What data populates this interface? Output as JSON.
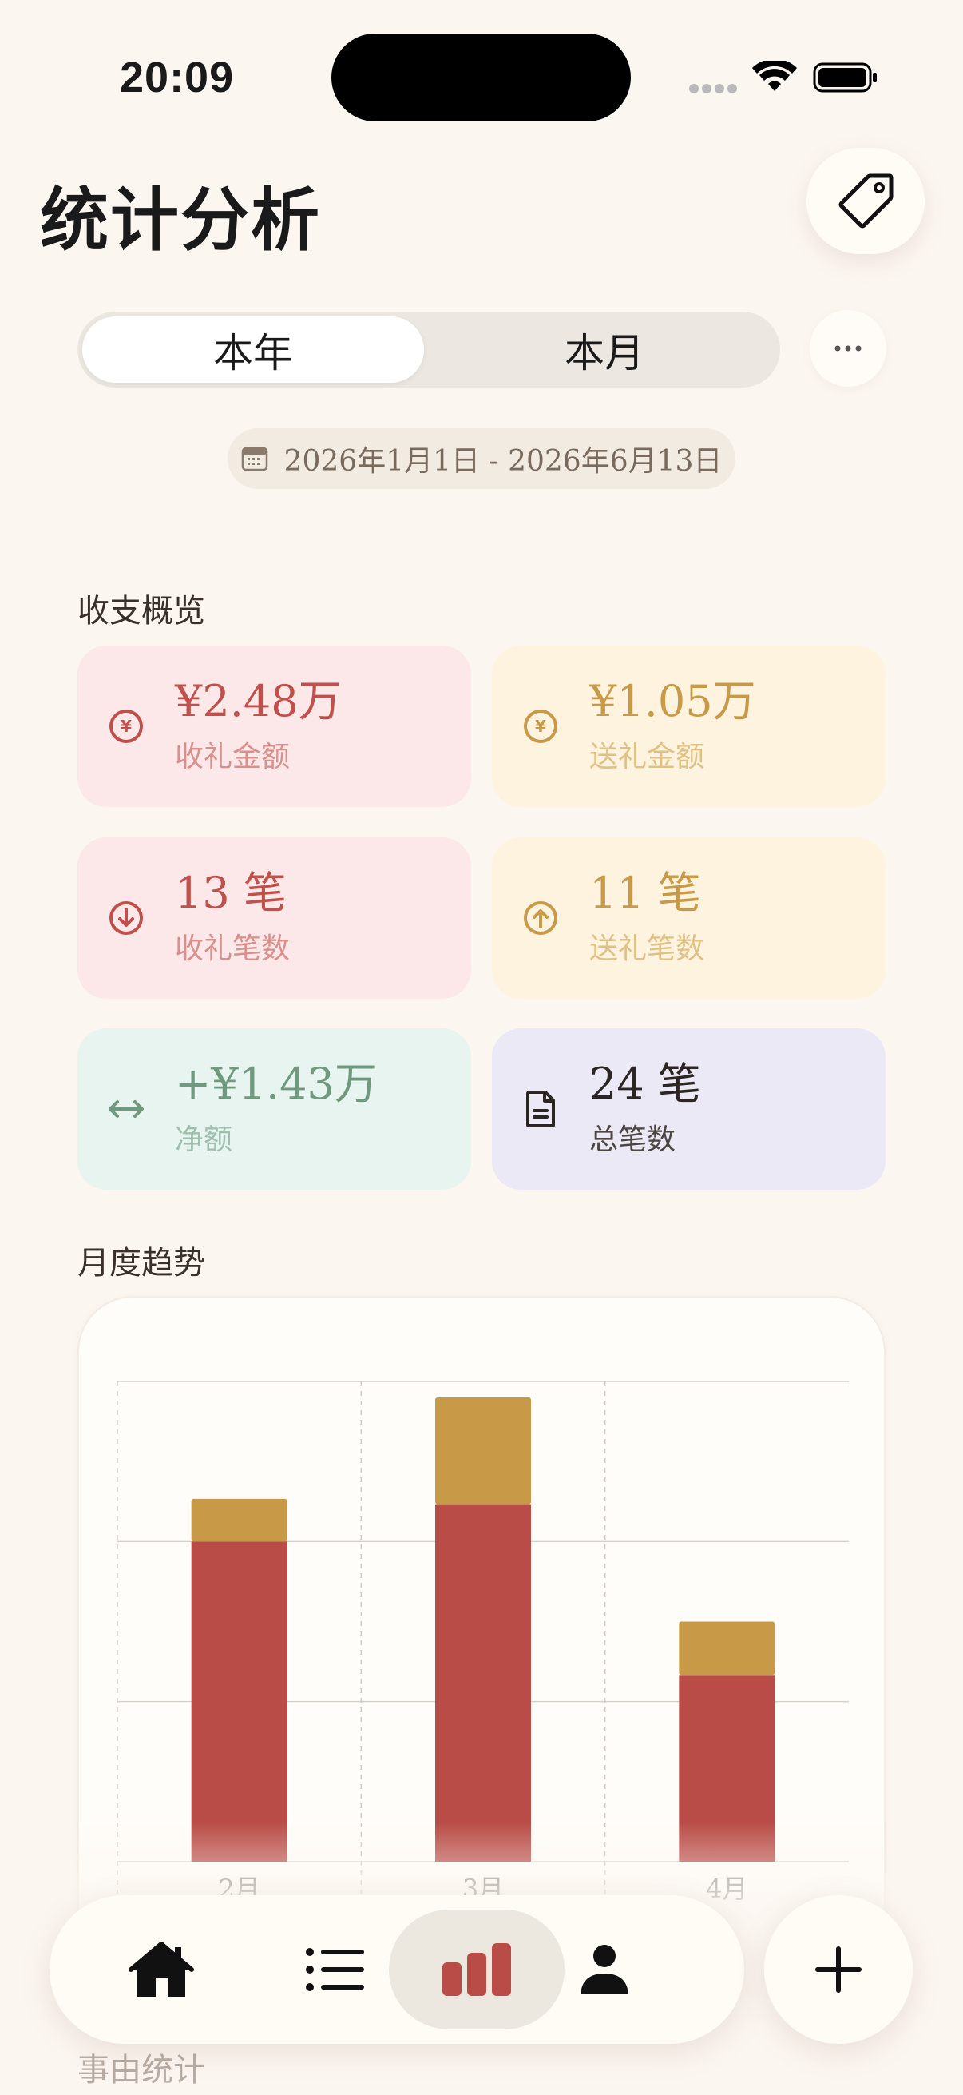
{
  "status": {
    "time": "20:09"
  },
  "header": {
    "title": "统计分析",
    "tag_icon": "tag-icon"
  },
  "period": {
    "options": [
      "本年",
      "本月"
    ],
    "selected": "本年",
    "more_icon": "ellipsis-icon"
  },
  "date_range": {
    "text": "2026年1月1日 - 2026年6月13日",
    "icon": "calendar-icon"
  },
  "overview": {
    "title": "收支概览",
    "cards": [
      {
        "value": "¥2.48万",
        "label": "收礼金额",
        "icon": "yen-circle-icon"
      },
      {
        "value": "¥1.05万",
        "label": "送礼金额",
        "icon": "yen-circle-icon"
      },
      {
        "value": "13 笔",
        "label": "收礼笔数",
        "icon": "arrow-down-circle-icon"
      },
      {
        "value": "11 笔",
        "label": "送礼笔数",
        "icon": "arrow-up-circle-icon"
      },
      {
        "value": "+¥1.43万",
        "label": "净额",
        "icon": "arrows-left-right-icon"
      },
      {
        "value": "24 笔",
        "label": "总笔数",
        "icon": "document-icon"
      }
    ]
  },
  "trend": {
    "title": "月度趋势"
  },
  "chart_data": {
    "type": "bar",
    "stacked": true,
    "categories": [
      "2月",
      "3月",
      "4月"
    ],
    "series": [
      {
        "values": [
          6000,
          6700,
          3500
        ],
        "color": "#b94c47"
      },
      {
        "values": [
          800,
          2000,
          1000
        ],
        "color": "#c89a48"
      }
    ],
    "ylim": [
      0,
      9000
    ],
    "grid": true
  },
  "next_section": {
    "title": "事由统计"
  },
  "nav": {
    "items": [
      {
        "icon": "home-icon"
      },
      {
        "icon": "list-icon"
      },
      {
        "icon": "bar-chart-icon",
        "active": true
      },
      {
        "icon": "person-icon"
      }
    ],
    "add_icon": "plus-icon"
  },
  "colors": {
    "accent_red": "#b94c47",
    "accent_gold": "#c89a48",
    "background": "#fcf6f1"
  }
}
